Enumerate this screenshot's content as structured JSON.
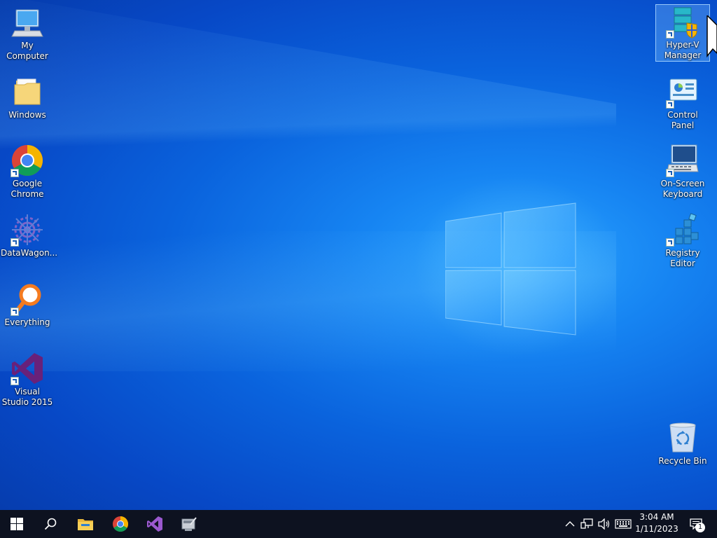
{
  "desktop": {
    "left_icons": [
      {
        "label": "My Computer",
        "icon": "computer-icon"
      },
      {
        "label": "Windows",
        "icon": "folder-icon"
      },
      {
        "label": "Google Chrome",
        "icon": "chrome-icon"
      },
      {
        "label": "DataWagon...",
        "icon": "datawagon-icon"
      },
      {
        "label": "Everything",
        "icon": "everything-icon"
      },
      {
        "label": "Visual Studio 2015",
        "icon": "visual-studio-icon"
      }
    ],
    "right_icons": [
      {
        "label": "Hyper-V Manager",
        "icon": "hyper-v-icon",
        "selected": true
      },
      {
        "label": "Control Panel",
        "icon": "control-panel-icon"
      },
      {
        "label": "On-Screen Keyboard",
        "icon": "keyboard-icon"
      },
      {
        "label": "Registry Editor",
        "icon": "registry-icon"
      },
      {
        "label": "Recycle Bin",
        "icon": "recycle-bin-icon"
      }
    ]
  },
  "taskbar": {
    "pinned": [
      "start-icon",
      "search-icon",
      "file-explorer-icon",
      "chrome-icon",
      "visual-studio-icon",
      "server-manager-icon"
    ],
    "tray_icons": [
      "chevron-up-icon",
      "network-icon",
      "volume-icon",
      "touch-keyboard-icon"
    ],
    "clock": {
      "time": "3:04 AM",
      "date": "1/11/2023"
    },
    "notification_count": "1"
  },
  "colors": {
    "taskbar": "#0d1220",
    "wallpaper_accent": "#1684f2"
  }
}
